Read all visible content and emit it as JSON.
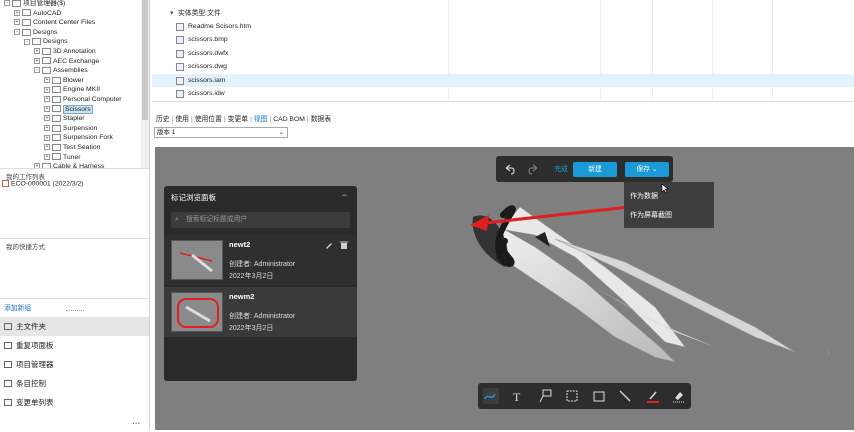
{
  "tree": {
    "items": [
      {
        "label": "项目管理器($)",
        "depth": 0,
        "exp": "-"
      },
      {
        "label": "AutoCAD",
        "depth": 1,
        "exp": "+"
      },
      {
        "label": "Content Center Files",
        "depth": 1,
        "exp": "+"
      },
      {
        "label": "Designs",
        "depth": 1,
        "exp": "-"
      },
      {
        "label": "Designs",
        "depth": 2,
        "exp": "-"
      },
      {
        "label": "3D Annotation",
        "depth": 3,
        "exp": "+"
      },
      {
        "label": "AEC Exchange",
        "depth": 3,
        "exp": "+"
      },
      {
        "label": "Assemblies",
        "depth": 3,
        "exp": "-"
      },
      {
        "label": "Blower",
        "depth": 4,
        "exp": "+"
      },
      {
        "label": "Engine MKII",
        "depth": 4,
        "exp": "+"
      },
      {
        "label": "Personal Computer",
        "depth": 4,
        "exp": "+"
      },
      {
        "label": "Scissors",
        "depth": 4,
        "exp": "+",
        "selected": true
      },
      {
        "label": "Stapler",
        "depth": 4,
        "exp": "+"
      },
      {
        "label": "Surpension",
        "depth": 4,
        "exp": "+"
      },
      {
        "label": "Surpension Fork",
        "depth": 4,
        "exp": "+"
      },
      {
        "label": "Test Seation",
        "depth": 4,
        "exp": "+"
      },
      {
        "label": "Tuner",
        "depth": 4,
        "exp": "+"
      },
      {
        "label": "Cable & Harness",
        "depth": 3,
        "exp": "+"
      }
    ]
  },
  "worklist": {
    "title": "我的工作列表",
    "item": "ECO-000001 (2022/3/2)"
  },
  "shortcuts": {
    "title": "我的快捷方式",
    "add": "添加新组",
    "more": "..."
  },
  "nav": [
    "主文件夹",
    "重复项面板",
    "项目管理器",
    "条目控制",
    "变更单列表"
  ],
  "files": {
    "group": "实体类型:文件",
    "rows": [
      "Readme Scisors.htm",
      "scissors.bmp",
      "scissors.dwfx",
      "scissors.dwg",
      "scissors.iam",
      "scissors.idw"
    ]
  },
  "tabs": [
    "历史",
    "使用",
    "使用位置",
    "变更单",
    "视图",
    "CAD BOM",
    "数据表"
  ],
  "active_tab": "视图",
  "version": "版本 1",
  "toolbar": {
    "done": "完成",
    "new": "新建",
    "save": "保存"
  },
  "save_menu": [
    "作为数据",
    "作为屏幕截图"
  ],
  "markup_panel": {
    "title": "标记浏览面板",
    "search_placeholder": "搜索标记标题或用户",
    "cards": [
      {
        "name": "newt2",
        "creator": "创建者: Administrator",
        "date": "2022年3月2日"
      },
      {
        "name": "newm2",
        "creator": "创建者: Administrator",
        "date": "2022年3月2日"
      }
    ]
  },
  "colors": {
    "accent": "#1a9bd7",
    "markup": "#e02020",
    "viewer_bg": "#7f7f7f",
    "panel_bg": "#2a2a2a"
  }
}
